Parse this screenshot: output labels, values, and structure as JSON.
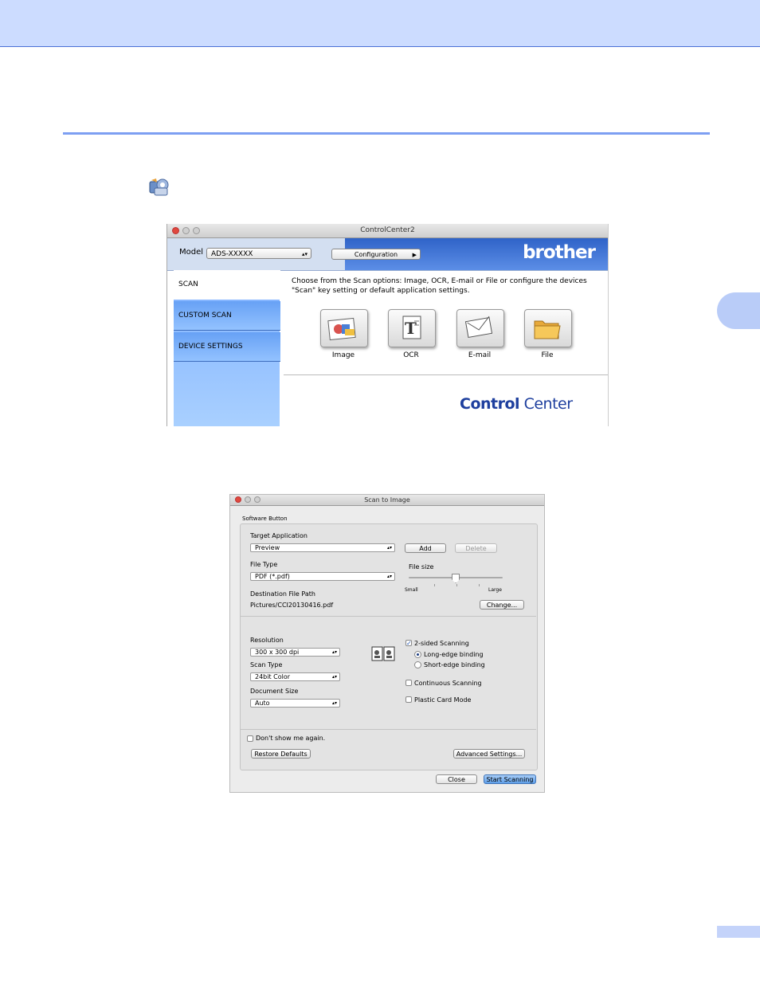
{
  "controlcenter": {
    "title": "ControlCenter2",
    "model_label": "Model",
    "model_value": "ADS-XXXXX",
    "configuration_label": "Configuration",
    "brand_logo": "brother",
    "nav": [
      "SCAN",
      "CUSTOM SCAN",
      "DEVICE SETTINGS"
    ],
    "description": "Choose from the Scan options: Image, OCR, E-mail or File or configure the devices \"Scan\" key setting or default application settings.",
    "tiles": [
      {
        "label": "Image",
        "icon": "image-icon"
      },
      {
        "label": "OCR",
        "icon": "ocr-icon"
      },
      {
        "label": "E-mail",
        "icon": "email-icon"
      },
      {
        "label": "File",
        "icon": "folder-icon"
      }
    ],
    "footer_logo_bold": "Control",
    "footer_logo_thin": " Center"
  },
  "dialog": {
    "title": "Scan to Image",
    "group_label": "Software Button",
    "target_app_label": "Target Application",
    "target_app_value": "Preview",
    "add_label": "Add",
    "delete_label": "Delete",
    "file_type_label": "File Type",
    "file_type_value": "PDF (*.pdf)",
    "file_size_label": "File size",
    "file_size_small": "Small",
    "file_size_large": "Large",
    "file_size_level": 0.5,
    "dest_path_label": "Destination File Path",
    "dest_path_value": "Pictures/CCI20130416.pdf",
    "change_label": "Change...",
    "resolution_label": "Resolution",
    "resolution_value": "300 x 300 dpi",
    "scan_type_label": "Scan Type",
    "scan_type_value": "24bit Color",
    "doc_size_label": "Document Size",
    "doc_size_value": "Auto",
    "two_sided_label": "2-sided Scanning",
    "two_sided_checked": true,
    "long_edge_label": "Long-edge binding",
    "short_edge_label": "Short-edge binding",
    "continuous_label": "Continuous Scanning",
    "plastic_label": "Plastic Card Mode",
    "dont_show_label": "Don't show me again.",
    "restore_label": "Restore Defaults",
    "advanced_label": "Advanced Settings...",
    "close_label": "Close",
    "start_label": "Start Scanning"
  },
  "colors": {
    "page_band": "#ccdcff",
    "rule": "#7d9ff2",
    "brand_blue": "#2f63c8"
  }
}
